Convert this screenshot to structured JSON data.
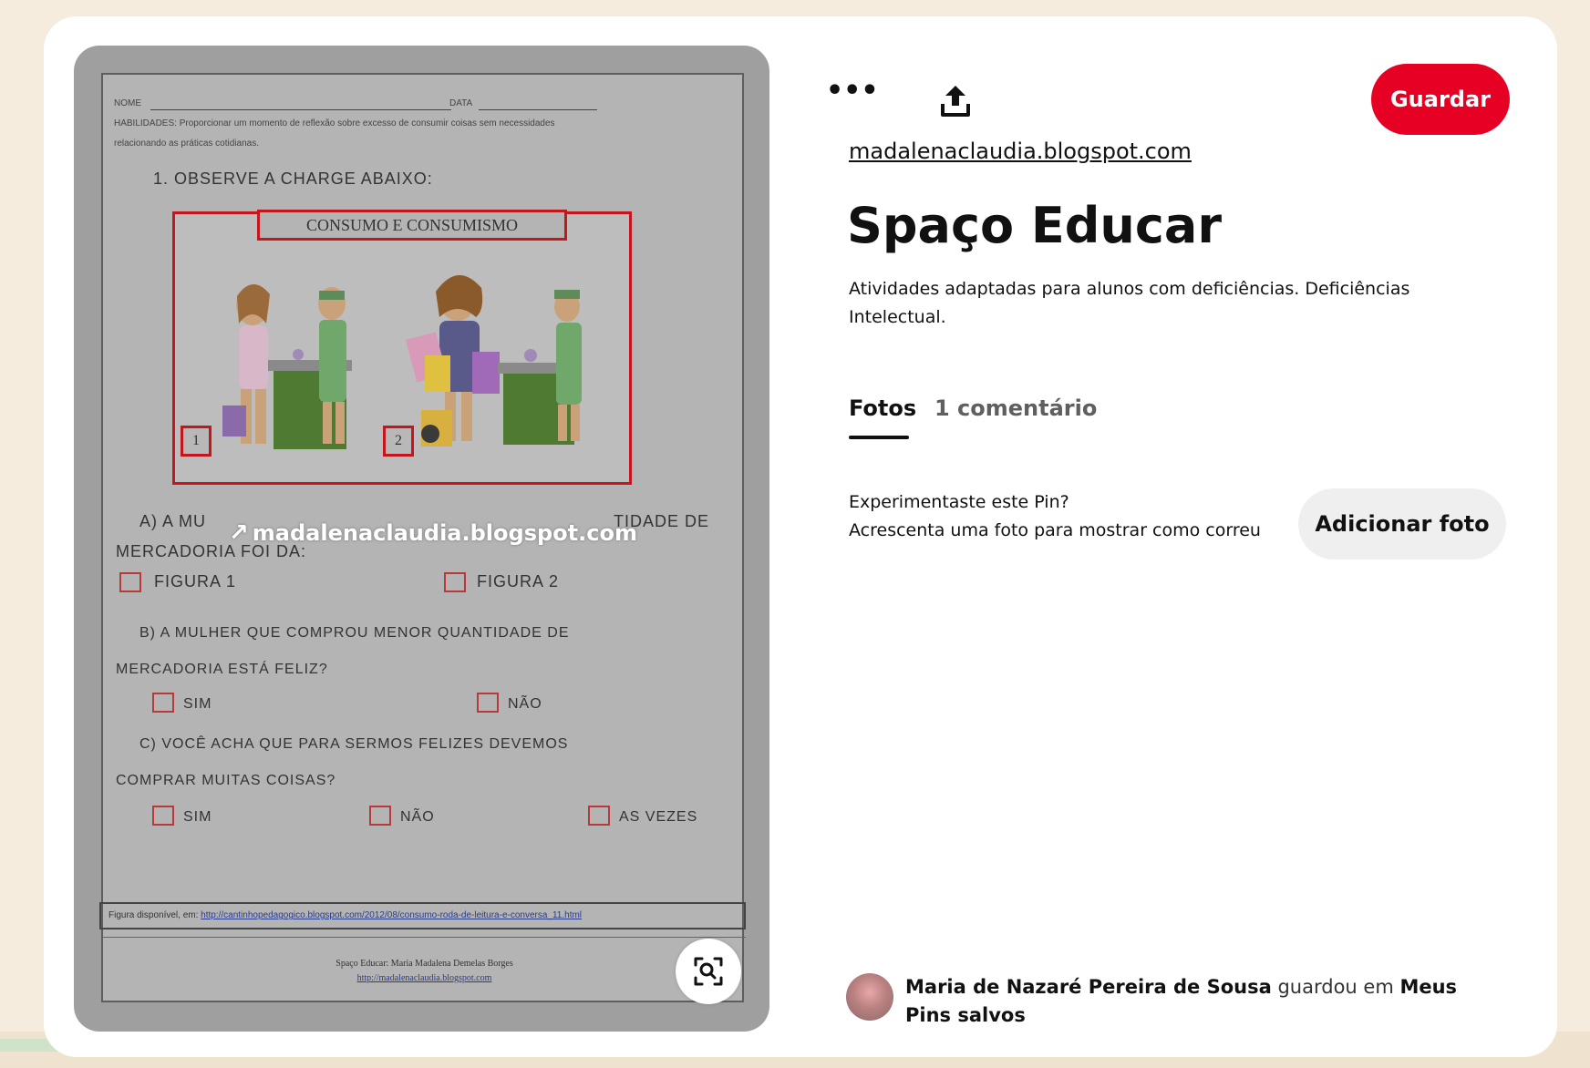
{
  "pin": {
    "source_domain": "madalenaclaudia.blogspot.com",
    "title": "Spaço Educar",
    "description": "Atividades adaptadas para alunos com deficiências. Deficiências Intelectual.",
    "save_label": "Guardar",
    "more_label": "•••"
  },
  "tabs": [
    {
      "label": "Fotos",
      "active": true
    },
    {
      "label": "1 comentário",
      "active": false
    }
  ],
  "tried": {
    "line1": "Experimentaste este Pin?",
    "line2": "Acrescenta uma foto para mostrar como correu",
    "button_label": "Adicionar foto"
  },
  "saver": {
    "name": "Maria de Nazaré Pereira de Sousa",
    "action": "guardou em",
    "board": "Meus Pins salvos"
  },
  "image": {
    "watermark": "madalenaclaudia.blogspot.com",
    "worksheet": {
      "nome_label": "NOME",
      "data_label": "DATA",
      "habilidades_line1": "HABILIDADES: Proporcionar um momento de reflexão sobre excesso de consumir coisas sem necessidades",
      "habilidades_line2": "relacionando as práticas cotidianas.",
      "q1": "1.  OBSERVE    A    CHARGE   ABAIXO:",
      "charge_title": "CONSUMO   E   CONSUMISMO",
      "fig1_num": "1",
      "fig2_num": "2",
      "qa_line1_left": "A)  A   MU",
      "qa_line1_right": "TIDADE    DE",
      "qa_line2": "MERCADORIA   FOI   DA:",
      "opt_figura1": "FIGURA  1",
      "opt_figura2": "FIGURA  2",
      "qb_line1": "B)  A    MULHER    QUE    COMPROU    MENOR      QUANTIDADE    DE",
      "qb_line2": "MERCADORIA   ESTÁ    FELIZ?",
      "opt_sim": "SIM",
      "opt_nao": "NÃO",
      "qc_line1": "C)   VOCÊ     ACHA     QUE    PARA     SERMOS     FELIZES     DEVEMOS",
      "qc_line2": "COMPRAR    MUITAS    COISAS?",
      "opt_as_vezes": "AS   VEZES",
      "ref_prefix": "Figura disponível, em: ",
      "ref_link": "http://cantinhopedagogico.blogspot.com/2012/08/consumo-roda-de-leitura-e-conversa_11.html",
      "credit_line": "Spaço Educar:  Maria Madalena Demelas Borges",
      "credit_link": "http://madalenaclaudia.blogspot.com"
    }
  },
  "colors": {
    "save_button": "#e60023",
    "add_photo_button": "#efefef",
    "page_background": "#f5ecde"
  }
}
